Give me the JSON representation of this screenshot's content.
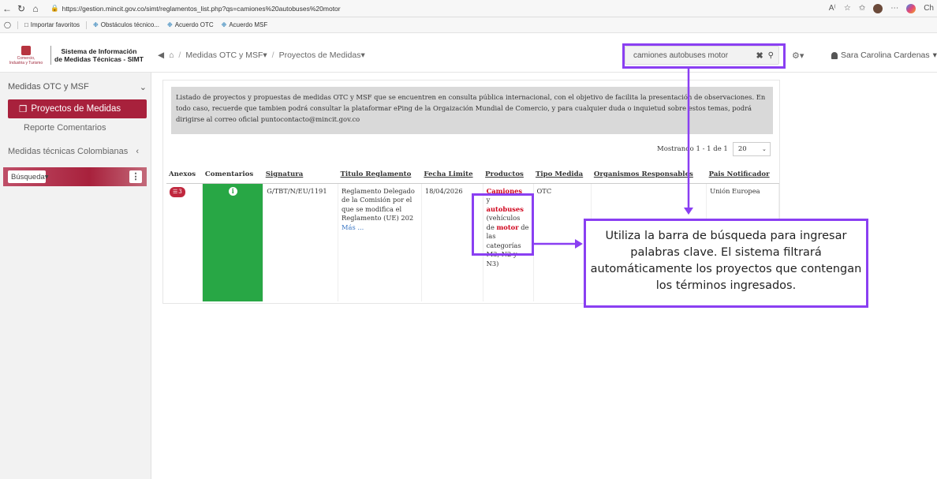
{
  "browser": {
    "url": "https://gestion.mincit.gov.co/simt/reglamentos_list.php?qs=camiones%20autobuses%20motor",
    "right_partial": "Ch",
    "favorites": [
      "Importar favoritos",
      "Obstáculos técnico...",
      "Acuerdo OTC",
      "Acuerdo MSF"
    ]
  },
  "header": {
    "logo_lines": [
      "Comercio,",
      "Industria y Turismo"
    ],
    "system_title": [
      "Sistema de Información",
      "de Medidas Técnicas - SIMT"
    ],
    "breadcrumb": [
      "Medidas OTC y MSF",
      "Proyectos de Medidas"
    ],
    "search_value": "camiones autobuses motor",
    "user_name": "Sara Carolina Cardenas"
  },
  "sidebar": {
    "section": "Medidas OTC y MSF",
    "active_item": "Proyectos de Medidas",
    "item": "Reporte Comentarios",
    "section2": "Medidas técnicas Colombianas",
    "busqueda_label": "Búsqueda"
  },
  "main": {
    "info_text": "Listado de proyectos y propuestas de medidas OTC y MSF que se encuentren en consulta pública internacional, con el objetivo de facilita la presentación de observaciones. En todo caso, recuerde que tambien podrá consultar la plataformar ePing de la Orgaización Mundial de Comercio, y para cualquier duda o inquietud sobre estos temas, podrá dirigirse al correo oficial puntocontacto@mincit.gov.co",
    "showing": "Mostrando 1 - 1 de 1",
    "page_size": "20",
    "columns": [
      "Anexos",
      "Comentarios",
      "Signatura",
      "Titulo Reglamento",
      "Fecha Limite",
      "Productos",
      "Tipo Medida",
      "Organismos Responsables",
      "Pais Notificador"
    ],
    "row": {
      "anexos_count": "3",
      "signatura": "G/TBT/N/EU/1191",
      "titulo": "Reglamento Delegado de la Comisión por el que se modifica el Reglamento (UE) 202",
      "mas": "Más ...",
      "fecha": "18/04/2026",
      "prod_1": "Camiones",
      "prod_2": "y",
      "prod_3": "autobuses",
      "prod_4": "(vehículos de",
      "prod_5": "motor",
      "prod_6": "de las categorías M3, N2 y N3)",
      "tipo": "OTC",
      "organismos": "",
      "pais": "Unión Europea"
    }
  },
  "callout": {
    "text": "Utiliza la barra de búsqueda para ingresar palabras clave. El sistema filtrará automáticamente los proyectos que contengan los términos ingresados."
  },
  "colors": {
    "accent_red": "#a8213c",
    "highlight_purple": "#8a3ff2",
    "comment_green": "#28a745"
  }
}
